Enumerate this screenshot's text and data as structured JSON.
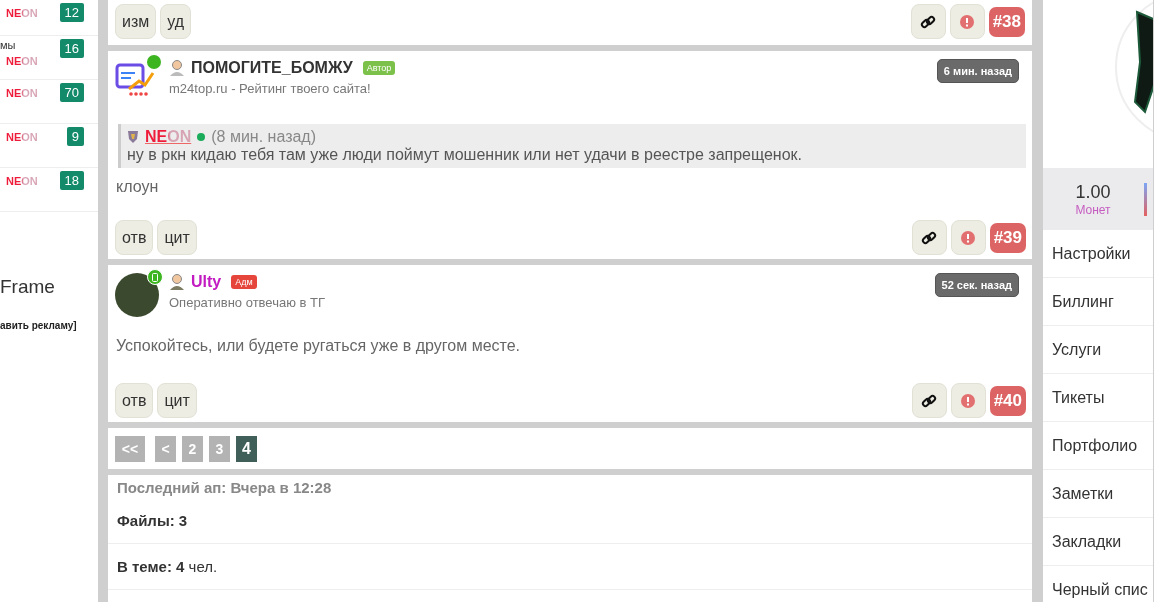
{
  "left_list": [
    {
      "user": "NEON",
      "count": "12"
    },
    {
      "prefix": "мы",
      "user": "NEON",
      "count": "16"
    },
    {
      "user": "NEON",
      "count": "70"
    },
    {
      "user": "NEON",
      "count": "9"
    },
    {
      "user": "NEON",
      "count": "18"
    }
  ],
  "left_widget": {
    "title": "Frame",
    "link": "авить рекламу]"
  },
  "top_post": {
    "actions": [
      "изм",
      "уд"
    ],
    "number": "#38"
  },
  "posts": [
    {
      "kind": "logo",
      "online": true,
      "mobile": false,
      "author": {
        "name": "ПОМОГИТЕ_БОМЖУ",
        "color": "#333333"
      },
      "badge": {
        "label": "Автор",
        "kind": "author"
      },
      "subtitle": "m24top.ru - Рейтинг твоего сайта!",
      "time": "6 мин. назад",
      "quote": {
        "author": "NEON",
        "online": true,
        "time": "(8 мин. назад)",
        "text": "ну в ркн кидаю тебя там уже люди поймут мошенник или нет удачи в реестре запрещенок."
      },
      "text": "клоун",
      "actions": [
        "отв",
        "цит"
      ],
      "number": "#39"
    },
    {
      "kind": "photo",
      "online": true,
      "mobile": true,
      "author": {
        "name": "Ulty",
        "color": "#c21bc2"
      },
      "badge": {
        "label": "Адм",
        "kind": "admin"
      },
      "subtitle": "Оперативно отвечаю в ТГ",
      "time": "52 сек. назад",
      "text": "Успокойтесь, или будете ругаться уже в другом месте.",
      "actions": [
        "отв",
        "цит"
      ],
      "number": "#40"
    }
  ],
  "pagination": [
    {
      "label": "<<",
      "selected": false
    },
    {
      "label": "<",
      "selected": false
    },
    {
      "label": "2",
      "selected": false
    },
    {
      "label": "3",
      "selected": false
    },
    {
      "label": "4",
      "selected": true
    }
  ],
  "info": {
    "last_update": "Последний ап: Вчера в 12:28",
    "files": "Файлы: 3",
    "members": "**В теме: 4** чел."
  },
  "profile": {
    "coins": "1.00",
    "coins_label": "Монет",
    "menu": [
      "Настройки",
      "Биллинг",
      "Услуги",
      "Тикеты",
      "Портфолио",
      "Заметки",
      "Закладки",
      "Черный спис"
    ]
  }
}
